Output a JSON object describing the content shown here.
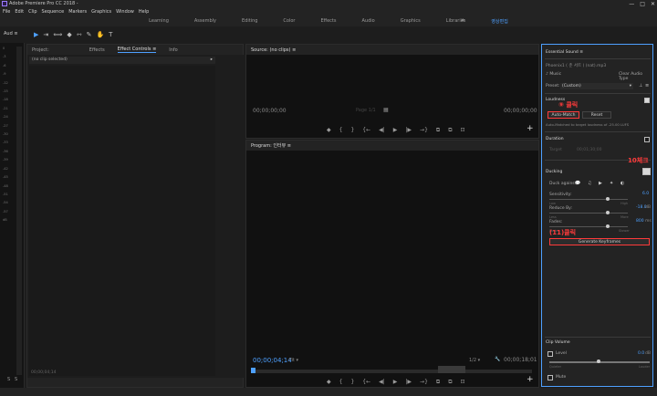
{
  "app": {
    "title": "Adobe Premiere Pro CC 2018 - ",
    "window_controls": [
      "—",
      "□",
      "✕"
    ]
  },
  "menu": [
    "File",
    "Edit",
    "Clip",
    "Sequence",
    "Markers",
    "Graphics",
    "Window",
    "Help"
  ],
  "workspaces": {
    "tabs": [
      "Learning",
      "Assembly",
      "Editing",
      "Color",
      "Effects",
      "Audio",
      "Graphics",
      "Libraries",
      "영상편집"
    ],
    "active_index": 8,
    "more": "»"
  },
  "toolbar": {
    "audio_tab": "Aud",
    "audio_tab_menu": "≡",
    "tools": [
      "▶",
      "⇥",
      "⟺",
      "◆",
      "⇿",
      "✎",
      "✋",
      "T"
    ]
  },
  "meter": {
    "scale": [
      "0",
      "-3",
      "-6",
      "-9",
      "-12",
      "-15",
      "-18",
      "-21",
      "-24",
      "-27",
      "-30",
      "-33",
      "-36",
      "-39",
      "-42",
      "-45",
      "-48",
      "-51",
      "-54",
      "-57",
      "dB"
    ],
    "footer": [
      "S",
      "S"
    ]
  },
  "left_panel": {
    "tabs": [
      "Project:",
      "Effects",
      "Effect Controls",
      "Info"
    ],
    "active_tab": 2,
    "tab_menu": "≡",
    "clip_label": "(no clip selected)",
    "clip_arrow": "▸",
    "timecode": "00;00;04;14"
  },
  "source_monitor": {
    "title": "Source: (no clips)",
    "title_menu": "≡",
    "tc_left": "00;00;00;00",
    "tc_mid": "Page 1/1",
    "tc_right": "00;00;00;00",
    "fit_icon": "▦",
    "controls": [
      "◆",
      "{",
      "}",
      "{←",
      "◀|",
      "▶",
      "|▶",
      "→}",
      "⧉",
      "⧉",
      "⊡"
    ],
    "add": "+"
  },
  "program_monitor": {
    "title": "Program: 인터뷰",
    "title_menu": "≡",
    "tc_left": "00;00;04;14",
    "fit": "Fit",
    "fit_arrow": "▾",
    "resolution": "1/2",
    "resolution_arrow": "▾",
    "wrench_icon": "🔧",
    "tc_right": "00;00;18;01",
    "controls": [
      "◆",
      "{",
      "}",
      "{←",
      "◀|",
      "▶",
      "|▶",
      "→}",
      "⧉",
      "⧉",
      "⊡"
    ],
    "add": "+",
    "marker_icon": "◆"
  },
  "essential_sound": {
    "title": "Essential Sound",
    "title_menu": "≡",
    "clip_name": "Phoenix1 ( 춘 서트 ) (nat).mp3",
    "clip_type": "Music",
    "clip_type_icon": "♪",
    "clear": "Clear Audio Type",
    "preset_label": "Preset:",
    "preset_value": "(Custom)",
    "preset_arrow": "▾",
    "preset_icons": [
      "⊥",
      "≡"
    ],
    "loudness": "Loudness",
    "auto_match": "Auto-Match",
    "reset": "Reset",
    "matched_note": "Auto-Matched to target loudness of -25.00 LUFS",
    "duration": "Duration",
    "target": "Target",
    "target_val": "00;01;30;00",
    "ducking": "Ducking",
    "duck_against": "Duck against:",
    "duck_icons": [
      "💬",
      "♫",
      "▶",
      "✦",
      "◐"
    ],
    "sensitivity": "Sensitivity:",
    "sens_val": "6.0",
    "sens_range": [
      "Low",
      "High"
    ],
    "reduce": "Reduce By:",
    "reduce_val": "-18.0",
    "reduce_unit": "dB",
    "reduce_range": [
      "Less",
      "More"
    ],
    "fades": "Fades:",
    "fades_val": "800",
    "fades_unit": "ms",
    "fades_range": [
      "Faster",
      "Slower"
    ],
    "generate": "Generate Keyframes",
    "clip_volume": "Clip Volume",
    "level": "Level",
    "level_val": "0.0",
    "level_unit": "dB",
    "level_range": [
      "Quieter",
      "Louder"
    ],
    "mute": "Mute"
  },
  "annotations": {
    "a9": "⑨ 클릭",
    "a10": "10체크",
    "a11": "(11)클릭"
  }
}
